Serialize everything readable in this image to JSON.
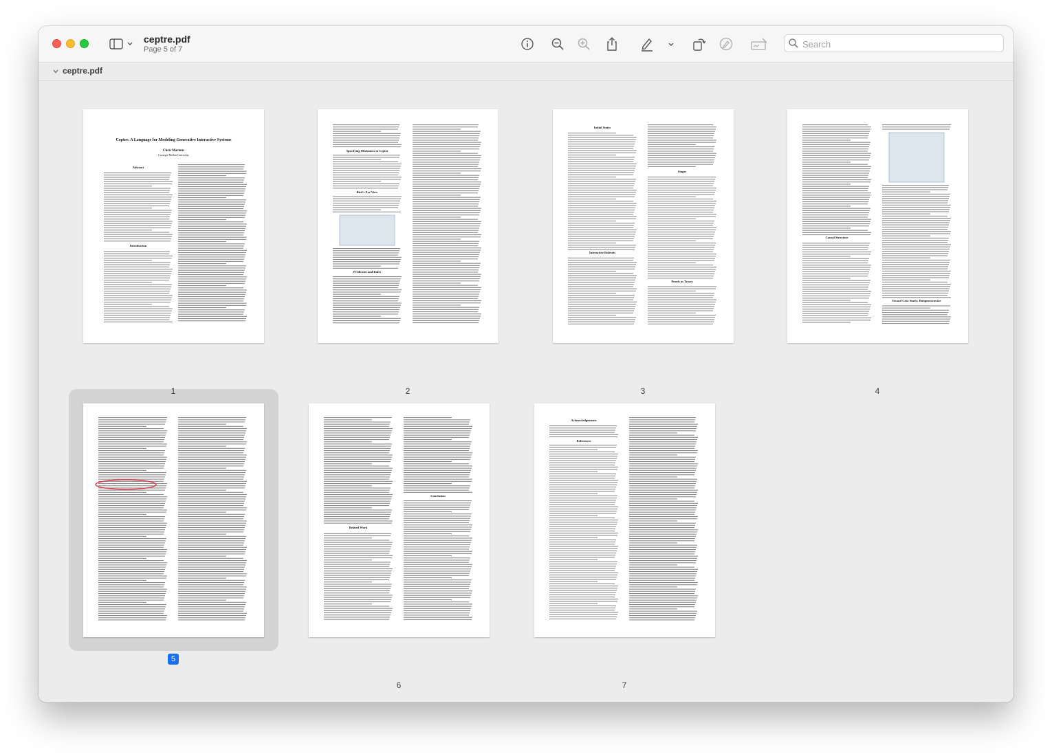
{
  "window": {
    "title": "ceptre.pdf",
    "subtitle": "Page 5 of 7",
    "search_placeholder": "Search",
    "sidebar_header": "ceptre.pdf"
  },
  "toolbar": {
    "icons": [
      "sidebar-toggle-icon",
      "chevron-down-icon",
      "info-icon",
      "zoom-out-icon",
      "zoom-in-icon",
      "share-icon",
      "highlight-pen-icon",
      "chevron-down-icon",
      "rotate-icon",
      "markup-icon",
      "signature-icon",
      "search-icon"
    ]
  },
  "pages": [
    {
      "number": "1",
      "title": "Ceptre: A Language for Modeling Generative Interactive Systems",
      "author": "Chris Martens",
      "affiliation": "Carnegie Mellon University",
      "headings": [
        "Abstract",
        "Introduction"
      ]
    },
    {
      "number": "2",
      "headings": [
        "Specifying Mechanics in Ceptre",
        "Bird's Eye View",
        "Predicates and Rules"
      ]
    },
    {
      "number": "3",
      "headings": [
        "Initial States",
        "Stages",
        "Interactive Rulesets",
        "Proofs as Traces"
      ]
    },
    {
      "number": "4",
      "headings": [
        "Causal Structure",
        "Second Case Study: Dungeoncrawler"
      ]
    },
    {
      "number": "5",
      "selected": true,
      "headings": []
    },
    {
      "number": "6",
      "headings": [
        "Related Work",
        "Conclusion"
      ]
    },
    {
      "number": "7",
      "headings": [
        "Acknowledgements",
        "References"
      ]
    }
  ],
  "colors": {
    "selection_badge": "#1a6ff0",
    "selection_frame": "#d3d3d3",
    "annotation_red": "#e0364a"
  }
}
